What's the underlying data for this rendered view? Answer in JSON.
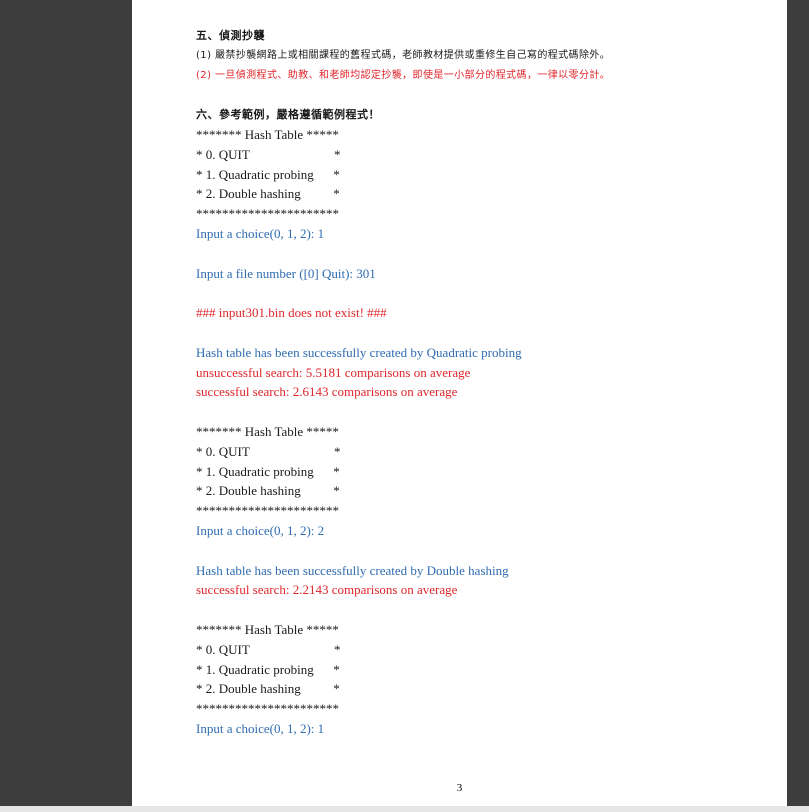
{
  "section5": {
    "title": "五、偵測抄襲",
    "rule1": "(1) 嚴禁抄襲網路上或相關課程的舊程式碼，老師教材提供或重修生自己寫的程式碼除外。",
    "rule2": "(2) 一旦偵測程式、助教、和老師均認定抄襲，即使是一小部分的程式碼，一律以零分計。"
  },
  "section6": {
    "title": "六、參考範例，嚴格遵循範例程式！"
  },
  "menu": {
    "header": "******* Hash Table *****",
    "opt0": "* 0. QUIT                          *",
    "opt1": "* 1. Quadratic probing      *",
    "opt2": "* 2. Double hashing          *",
    "footer": "**********************"
  },
  "run": {
    "choice1": "Input a choice(0, 1, 2): 1",
    "file_prompt": "Input a file number ([0] Quit): 301",
    "file_error": "### input301.bin does not exist! ###",
    "created_qp": "Hash table has been successfully created by Quadratic probing",
    "unsuccessful_qp": "unsuccessful search: 5.5181 comparisons on average",
    "successful_qp": "successful search: 2.6143 comparisons on average",
    "choice2": "Input a choice(0, 1, 2): 2",
    "created_dh": "Hash table has been successfully created by Double hashing",
    "successful_dh": "successful search: 2.2143 comparisons on average",
    "choice3": "Input a choice(0, 1, 2): 1"
  },
  "page_number": "3",
  "colors": {
    "blue_output": "#2f6cb0",
    "red_output": "#e0262b",
    "viewer_bg": "#3d3d3d"
  }
}
